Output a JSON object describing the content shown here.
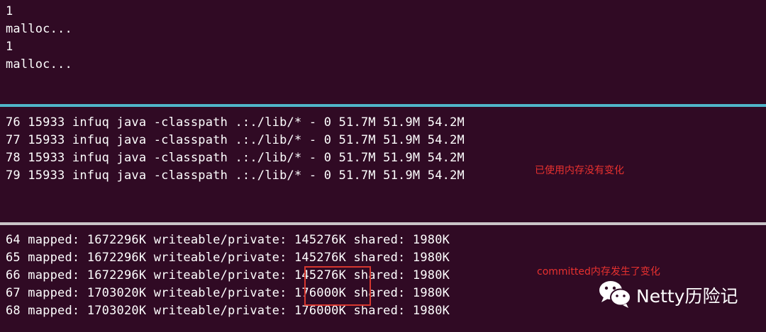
{
  "top_pane": {
    "lines": [
      "1",
      "malloc...",
      "1",
      "malloc..."
    ]
  },
  "middle_pane": {
    "lines": [
      "76 15933 infuq java -classpath .:./lib/* - 0 51.7M 51.9M 54.2M",
      "77 15933 infuq java -classpath .:./lib/* - 0 51.7M 51.9M 54.2M",
      "78 15933 infuq java -classpath .:./lib/* - 0 51.7M 51.9M 54.2M",
      "79 15933 infuq java -classpath .:./lib/* - 0 51.7M 51.9M 54.2M"
    ],
    "annotation": "已使用内存没有变化"
  },
  "bottom_pane": {
    "lines": [
      "64 mapped: 1672296K writeable/private: 145276K shared: 1980K",
      "65 mapped: 1672296K writeable/private: 145276K shared: 1980K",
      "66 mapped: 1672296K writeable/private: 145276K shared: 1980K",
      "67 mapped: 1703020K writeable/private: 176000K shared: 1980K",
      "68 mapped: 1703020K writeable/private: 176000K shared: 1980K"
    ],
    "annotation": "committed内存发生了变化"
  },
  "watermark": {
    "text": "Netty历险记",
    "icon": "wechat-icon"
  },
  "colors": {
    "background": "#300a24",
    "text": "#ffffff",
    "annotation": "#e8312f",
    "divider_active": "#4fb6c9",
    "divider": "#c9c4c7"
  }
}
